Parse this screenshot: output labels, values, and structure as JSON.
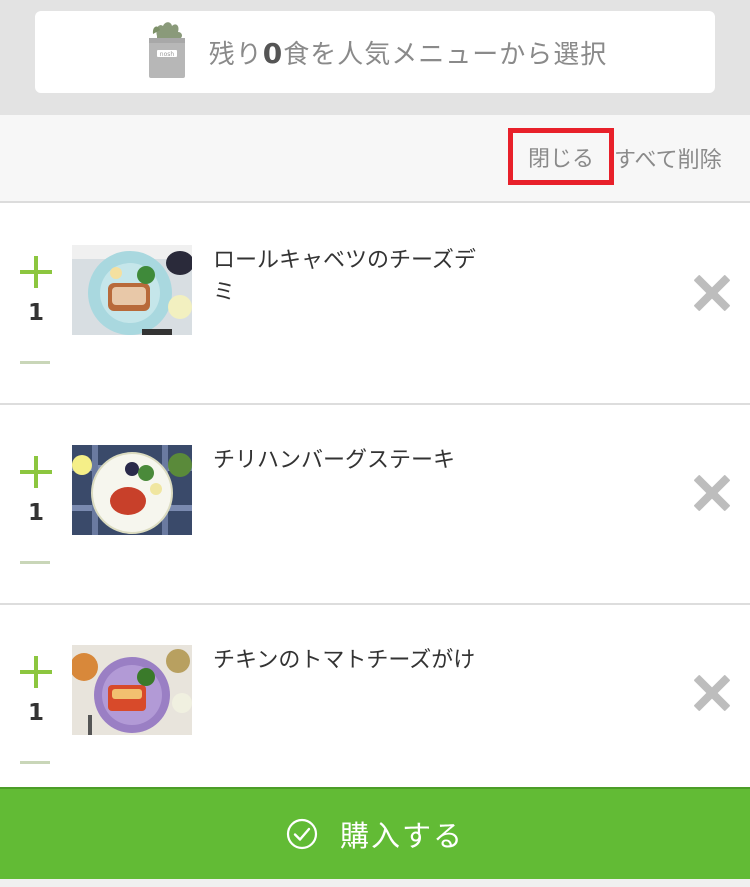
{
  "banner": {
    "text_before": "残り",
    "remaining_count": "0",
    "text_after": "食を人気メニューから選択",
    "bag_logo_text": "nosh"
  },
  "controls": {
    "close_label": "閉じる",
    "delete_all_label": "すべて削除"
  },
  "cart": {
    "items": [
      {
        "name": "ロールキャベツのチーズデミ",
        "quantity": "1",
        "plate_color": "#9fd3d9"
      },
      {
        "name": "チリハンバーグステーキ",
        "quantity": "1",
        "plate_color": "#f6f6ee"
      },
      {
        "name": "チキンのトマトチーズがけ",
        "quantity": "1",
        "plate_color": "#9a7fc4"
      }
    ]
  },
  "purchase": {
    "label": "購入する"
  },
  "colors": {
    "accent_green": "#62bb35",
    "plus_green": "#8cc63f",
    "highlight_red": "#e8202a"
  }
}
